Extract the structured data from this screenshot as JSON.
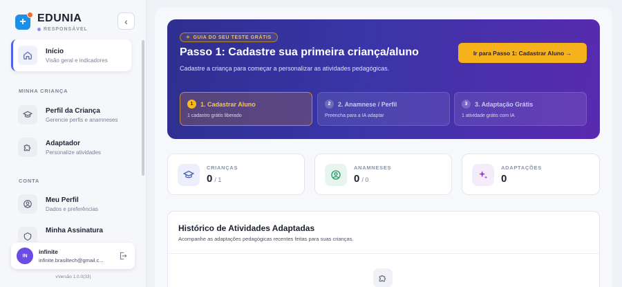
{
  "brand": {
    "name": "EDUNIA",
    "role": "RESPONSÁVEL"
  },
  "sidebar": {
    "collapse_glyph": "‹",
    "items": [
      {
        "title": "Início",
        "sub": "Visão geral e indicadores",
        "icon": "home-icon"
      },
      {
        "title": "Perfil da Criança",
        "sub": "Gerencie perfis e anamneses",
        "icon": "graduation-cap-icon"
      },
      {
        "title": "Adaptador",
        "sub": "Personalize atividades",
        "icon": "puzzle-icon"
      },
      {
        "title": "Meu Perfil",
        "sub": "Dados e preferências",
        "icon": "user-circle-icon"
      },
      {
        "title": "Minha Assinatura",
        "sub": "",
        "icon": "subscription-icon"
      }
    ],
    "sections": {
      "child": "MINHA CRIANÇA",
      "account": "CONTA"
    }
  },
  "user": {
    "initials": "IN",
    "name": "infinite",
    "email": "infinite.brasiltech@gmail.c..."
  },
  "version": "vVersão 1.0.0(33)",
  "hero": {
    "badge": "GUIA DO SEU TESTE GRÁTIS",
    "title": "Passo 1: Cadastre sua primeira criança/aluno",
    "subtitle": "Cadastre a criança para começar a personalizar as atividades pedagógicas.",
    "button": "Ir para Passo 1: Cadastrar Aluno →",
    "steps": [
      {
        "num": "1",
        "title": "1. Cadastrar Aluno",
        "sub": "1 cadastro grátis liberado"
      },
      {
        "num": "2",
        "title": "2. Anamnese / Perfil",
        "sub": "Preencha para a IA adaptar"
      },
      {
        "num": "3",
        "title": "3. Adaptação Grátis",
        "sub": "1 atividade grátis com IA"
      }
    ]
  },
  "stats": [
    {
      "label": "CRIANÇAS",
      "value": "0",
      "suffix": "/ 1",
      "icon": "graduation-cap-icon"
    },
    {
      "label": "ANAMNESES",
      "value": "0",
      "suffix": "/ 0",
      "icon": "user-circle-icon"
    },
    {
      "label": "ADAPTAÇÕES",
      "value": "0",
      "suffix": "",
      "icon": "sparkles-icon"
    }
  ],
  "history": {
    "title": "Histórico de Atividades Adaptadas",
    "subtitle": "Acompanhe as adaptações pedagógicas recentes feitas para suas crianças."
  },
  "colors": {
    "accent": "#5560e8",
    "cta": "#f6b21a",
    "hero_start": "#2e2f8f",
    "hero_end": "#5a2ab0"
  }
}
